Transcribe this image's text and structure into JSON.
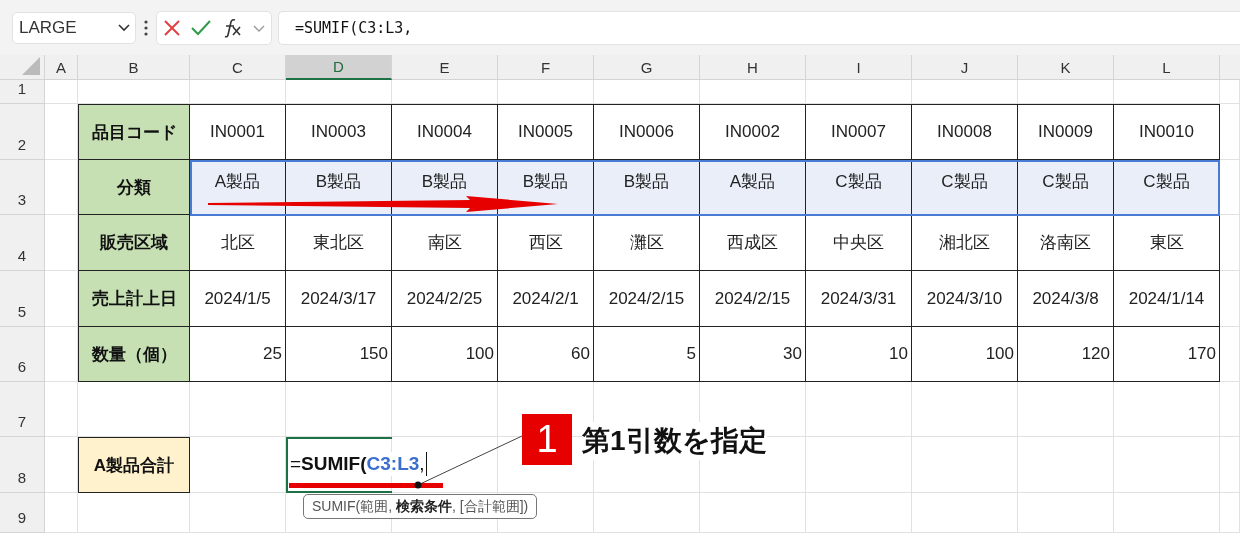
{
  "name_box": {
    "value": "LARGE"
  },
  "formula_bar": {
    "value": "=SUMIF(C3:L3,"
  },
  "columns": [
    {
      "label": "A",
      "selected": false
    },
    {
      "label": "B",
      "selected": false
    },
    {
      "label": "C",
      "selected": false
    },
    {
      "label": "D",
      "selected": true
    },
    {
      "label": "E",
      "selected": false
    },
    {
      "label": "F",
      "selected": false
    },
    {
      "label": "G",
      "selected": false
    },
    {
      "label": "H",
      "selected": false
    },
    {
      "label": "I",
      "selected": false
    },
    {
      "label": "J",
      "selected": false
    },
    {
      "label": "K",
      "selected": false
    },
    {
      "label": "L",
      "selected": false
    }
  ],
  "rows": [
    {
      "number": "1",
      "kind": "blank"
    },
    {
      "number": "2",
      "kind": "text",
      "header": "品目コード",
      "selected": false,
      "values": [
        "IN0001",
        "IN0003",
        "IN0004",
        "IN0005",
        "IN0006",
        "IN0002",
        "IN0007",
        "IN0008",
        "IN0009",
        "IN0010"
      ]
    },
    {
      "number": "3",
      "kind": "text",
      "header": "分類",
      "selected": true,
      "values": [
        "A製品",
        "B製品",
        "B製品",
        "B製品",
        "B製品",
        "A製品",
        "C製品",
        "C製品",
        "C製品",
        "C製品"
      ]
    },
    {
      "number": "4",
      "kind": "text",
      "header": "販売区域",
      "selected": false,
      "values": [
        "北区",
        "東北区",
        "南区",
        "西区",
        "灘区",
        "西成区",
        "中央区",
        "湘北区",
        "洛南区",
        "東区"
      ]
    },
    {
      "number": "5",
      "kind": "text",
      "header": "売上計上日",
      "selected": false,
      "values": [
        "2024/1/5",
        "2024/3/17",
        "2024/2/25",
        "2024/2/1",
        "2024/2/15",
        "2024/2/15",
        "2024/3/31",
        "2024/3/10",
        "2024/3/8",
        "2024/1/14"
      ]
    },
    {
      "number": "6",
      "kind": "number",
      "header": "数量（個）",
      "selected": false,
      "values": [
        "25",
        "150",
        "100",
        "60",
        "5",
        "30",
        "10",
        "100",
        "120",
        "170"
      ]
    },
    {
      "number": "7",
      "kind": "blank"
    },
    {
      "number": "8",
      "kind": "total",
      "label": "A製品合計",
      "formula": [
        {
          "kind": "operator",
          "text": "="
        },
        {
          "kind": "function",
          "text": "SUMIF("
        },
        {
          "kind": "reference",
          "text": "C3:L3"
        },
        {
          "kind": "operator",
          "text": ","
        }
      ]
    },
    {
      "number": "9",
      "kind": "blank"
    }
  ],
  "tooltip": "SUMIF(範囲, **検索条件**, [合計範囲])",
  "callout": {
    "number": "1",
    "text": "第1引数を指定"
  }
}
